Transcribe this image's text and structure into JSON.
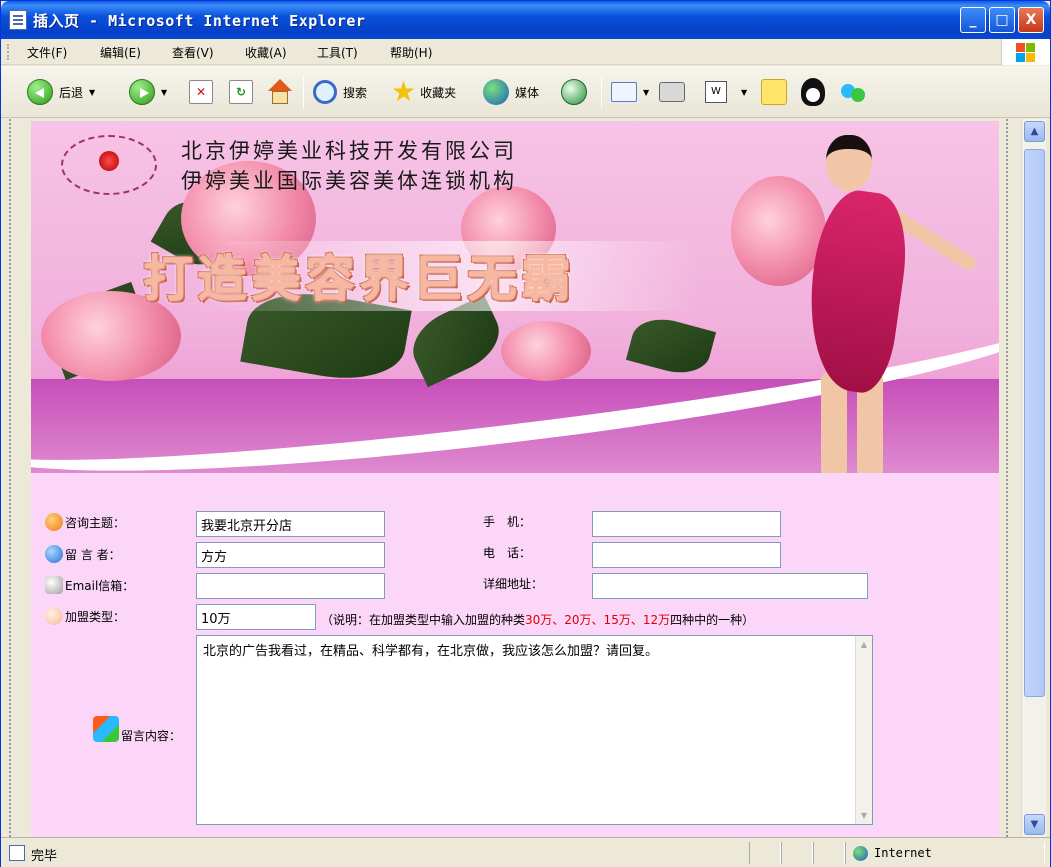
{
  "window": {
    "title": "插入页 - Microsoft Internet Explorer",
    "buttons": {
      "minimize": "_",
      "maximize": "□",
      "close": "X"
    }
  },
  "menu": [
    "文件(F)",
    "编辑(E)",
    "查看(V)",
    "收藏(A)",
    "工具(T)",
    "帮助(H)"
  ],
  "toolbar": {
    "back_label": "后退",
    "search_label": "搜索",
    "favorites_label": "收藏夹",
    "media_label": "媒体"
  },
  "banner": {
    "company_line1": "北京伊婷美业科技开发有限公司",
    "company_line2": "伊婷美业国际美容美体连锁机构",
    "slogan": "打造美容界巨无霸"
  },
  "form": {
    "subject_label": "咨询主题：",
    "subject_value": "我要北京开分店",
    "author_label": "留 言 者：",
    "author_value": "方方",
    "email_label": "Email信箱：",
    "email_value": "",
    "franchise_label": "加盟类型：",
    "franchise_value": "10万",
    "mobile_label": "手　机：",
    "mobile_value": "",
    "phone_label": "电　话：",
    "phone_value": "",
    "address_label": "详细地址：",
    "address_value": "",
    "note_prefix": "（说明：在加盟类型中输入加盟的种类",
    "note_options": "30万、20万、15万、12万",
    "note_suffix": "四种中的一种）",
    "message_label": "留言内容：",
    "message_value": "北京的广告我看过，在精品、科学都有，在北京做，我应该怎么加盟？请回复。"
  },
  "status": {
    "text": "完毕",
    "zone": "Internet"
  },
  "colors": {
    "title_bar": "#0a52dd",
    "page_bg": "#fbd6f8",
    "note_highlight": "#e00000"
  }
}
